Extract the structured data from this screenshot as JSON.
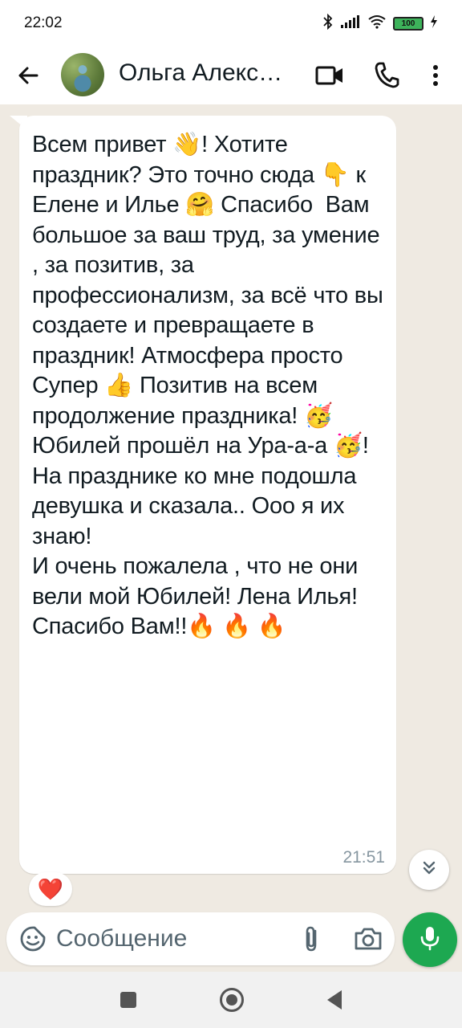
{
  "status_bar": {
    "time": "22:02",
    "battery": "100"
  },
  "header": {
    "contact_name": "Ольга Алекс…"
  },
  "message": {
    "text": "Всем привет 👋! Хотите праздник? Это точно сюда 👇 к Елене и Илье 🤗 Спасибо  Вам большое за ваш труд, за умение , за позитив, за профессионализм, за всё что вы создаете и превращаете в праздник! Атмосфера просто Супер 👍 Позитив на всем продолжение праздника! 🥳 Юбилей прошёл на Ура-а-а 🥳!\nНа празднике ко мне подошла девушка и сказала.. Ооо я их знаю!\nИ очень пожалела , что не они вели мой Юбилей! Лена Илья! Спасибо Вам!!🔥 🔥 🔥",
    "time": "21:51",
    "reaction": "❤️"
  },
  "composer": {
    "placeholder": "Сообщение"
  },
  "icons": {
    "back": "arrow-left",
    "video": "video-camera",
    "call": "phone",
    "menu": "vertical-dots",
    "emoji": "sticker-smile",
    "attach": "paperclip",
    "camera": "camera",
    "mic": "microphone",
    "scroll_down": "double-chevron-down"
  },
  "colors": {
    "chat_background": "#efeae2",
    "accent_green": "#1da851",
    "time_gray": "#8696a0"
  }
}
